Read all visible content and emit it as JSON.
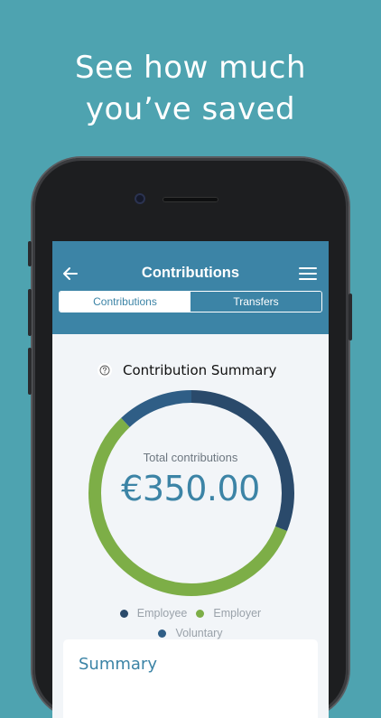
{
  "headline": {
    "line1": "See how much",
    "line2": "you’ve saved"
  },
  "appbar": {
    "title": "Contributions"
  },
  "tabs": [
    {
      "label": "Contributions",
      "active": true
    },
    {
      "label": "Transfers",
      "active": false
    }
  ],
  "icons": {
    "back": "arrow-left-icon",
    "menu": "hamburger-menu-icon",
    "help": "question-circle-icon"
  },
  "section": {
    "title": "Contribution Summary"
  },
  "donut": {
    "label": "Total contributions",
    "value": "€350.00",
    "segments": [
      {
        "name": "Employee",
        "fraction": 0.31,
        "color": "#2a4a6b"
      },
      {
        "name": "Employer",
        "fraction": 0.57,
        "color": "#7dae47"
      },
      {
        "name": "Voluntary",
        "fraction": 0.12,
        "color": "#2f5e86"
      }
    ]
  },
  "legend": [
    {
      "label": "Employee",
      "color": "#2a4a6b"
    },
    {
      "label": "Employer",
      "color": "#7dae47"
    },
    {
      "label": "Voluntary",
      "color": "#2f5e86"
    }
  ],
  "summary": {
    "title": "Summary"
  },
  "colors": {
    "background": "#4ea3b0",
    "accent": "#3c84a6"
  }
}
